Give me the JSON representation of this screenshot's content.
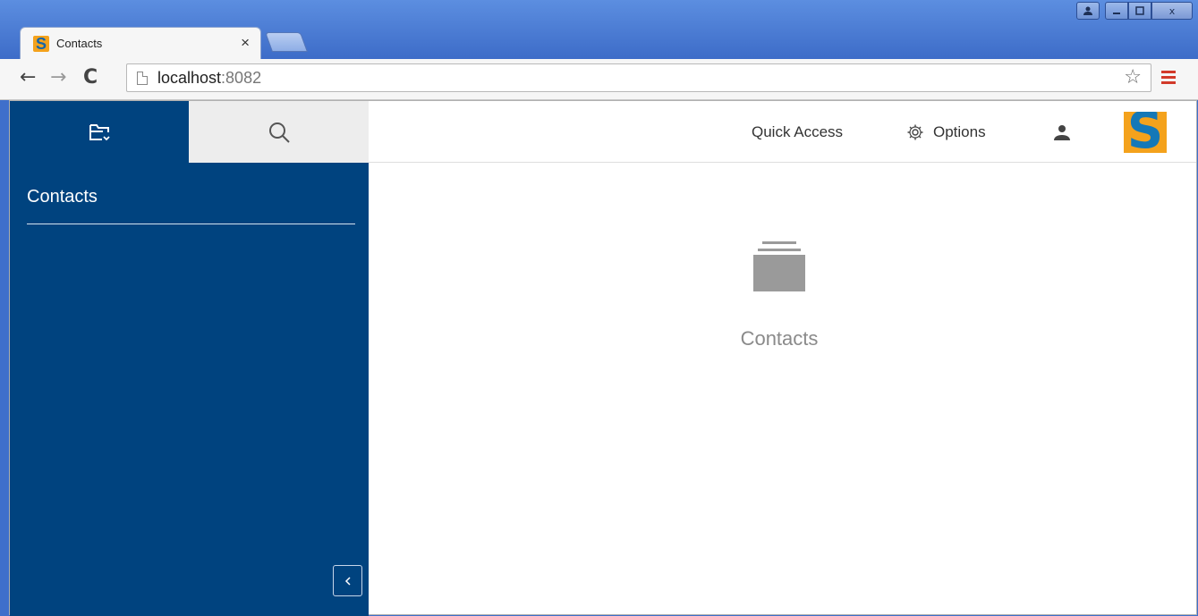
{
  "browser": {
    "tab_title": "Contacts",
    "tab_close": "×",
    "url_host": "localhost",
    "url_port": ":8082",
    "window_controls": {
      "user": "user-icon",
      "minimize": "minimize-icon",
      "maximize": "maximize-icon",
      "close": "x"
    }
  },
  "sidebar": {
    "tabs": [
      {
        "icon": "folder-outline-icon",
        "active": true
      },
      {
        "icon": "search-icon",
        "active": false
      }
    ],
    "nav_title": "Contacts",
    "collapse_icon": "chevron-left-icon"
  },
  "header": {
    "quick_access": "Quick Access",
    "options": "Options",
    "options_icon": "gear-icon",
    "user_icon": "user-icon",
    "logo_letter": "S"
  },
  "content": {
    "icon": "stack-icon",
    "label": "Contacts"
  },
  "colors": {
    "sidebar_bg": "#00437f",
    "logo_orange": "#f4a21c",
    "logo_blue": "#1478b7",
    "menu_red": "#d23a2a"
  }
}
